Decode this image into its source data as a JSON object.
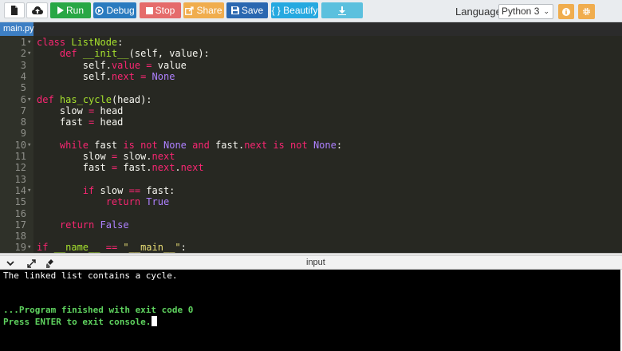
{
  "toolbar": {
    "run_label": "Run",
    "debug_label": "Debug",
    "stop_label": "Stop",
    "share_label": "Share",
    "save_label": "Save",
    "beautify_label": "{ } Beautify",
    "language_label": "Language",
    "language_value": "Python 3",
    "icons": [
      "new-file-icon",
      "upload-icon",
      "play-icon",
      "debug-icon",
      "stop-icon",
      "share-icon",
      "save-icon",
      "download-icon",
      "info-icon",
      "gear-icon"
    ]
  },
  "tabs": [
    {
      "label": "main.py",
      "active": true
    }
  ],
  "editor": {
    "lines": [
      {
        "n": "1",
        "text": "class ListNode:"
      },
      {
        "n": "2",
        "text": "    def __init__(self, value):"
      },
      {
        "n": "3",
        "text": "        self.value = value"
      },
      {
        "n": "4",
        "text": "        self.next = None"
      },
      {
        "n": "5",
        "text": ""
      },
      {
        "n": "6",
        "text": "def has_cycle(head):"
      },
      {
        "n": "7",
        "text": "    slow = head"
      },
      {
        "n": "8",
        "text": "    fast = head"
      },
      {
        "n": "9",
        "text": ""
      },
      {
        "n": "10",
        "text": "    while fast is not None and fast.next is not None:"
      },
      {
        "n": "11",
        "text": "        slow = slow.next"
      },
      {
        "n": "12",
        "text": "        fast = fast.next.next"
      },
      {
        "n": "13",
        "text": ""
      },
      {
        "n": "14",
        "text": "        if slow == fast:"
      },
      {
        "n": "15",
        "text": "            return True"
      },
      {
        "n": "16",
        "text": ""
      },
      {
        "n": "17",
        "text": "    return False"
      },
      {
        "n": "18",
        "text": ""
      },
      {
        "n": "19",
        "text": "if __name__ == \"__main__\":"
      }
    ],
    "fold_lines": [
      "1",
      "2",
      "6",
      "10",
      "14",
      "19"
    ]
  },
  "io": {
    "title": "input",
    "icons": [
      "chevron-down-icon",
      "expand-icon",
      "clear-icon"
    ]
  },
  "console": {
    "output_line": "The linked list contains a cycle.",
    "finished_line": "...Program finished with exit code 0",
    "exit_prompt": "Press ENTER to exit console."
  },
  "colors": {
    "run": "#28a745",
    "debug": "#2a7bbf",
    "stop": "#e56b6b",
    "share": "#f0ad4e",
    "save": "#2a67b0",
    "beautify": "#26a9e0",
    "download": "#5bc0de",
    "editor_bg": "#272822",
    "console_green": "#5fd35f"
  }
}
